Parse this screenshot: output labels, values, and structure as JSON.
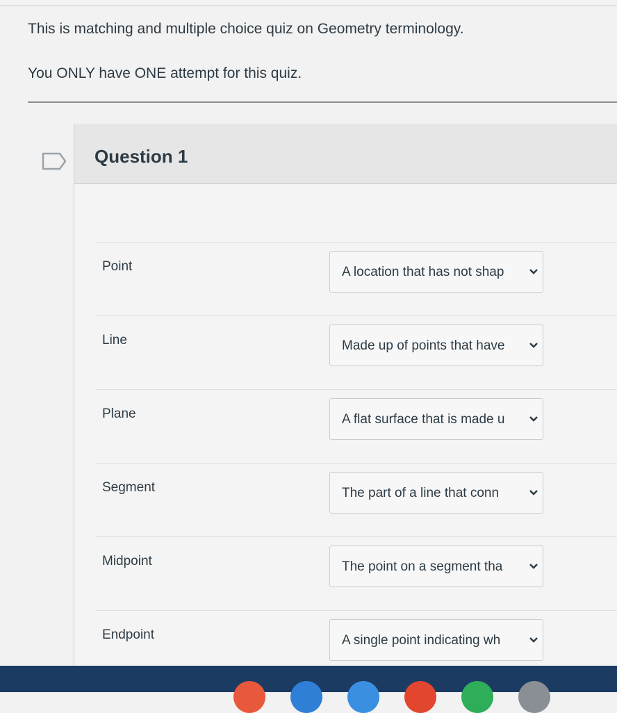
{
  "intro": {
    "line1": "This is matching and multiple choice quiz on Geometry terminology.",
    "line2": "You ONLY have ONE attempt for this quiz."
  },
  "question": {
    "title": "Question 1",
    "rows": [
      {
        "term": "Point",
        "answer": "A location that has not shap"
      },
      {
        "term": "Line",
        "answer": "Made up of points that have"
      },
      {
        "term": "Plane",
        "answer": "A flat surface that is made u"
      },
      {
        "term": "Segment",
        "answer": "The part of a line that conn"
      },
      {
        "term": "Midpoint",
        "answer": "The point on a segment tha"
      },
      {
        "term": "Endpoint",
        "answer": "A single point indicating wh"
      }
    ]
  },
  "icons": {
    "flag": "flag-icon",
    "dropdown": "chevron-down-icon"
  },
  "colors": {
    "taskbar": "#1b3b63",
    "text": "#2d3b45",
    "header_bg": "#e6e6e6"
  }
}
